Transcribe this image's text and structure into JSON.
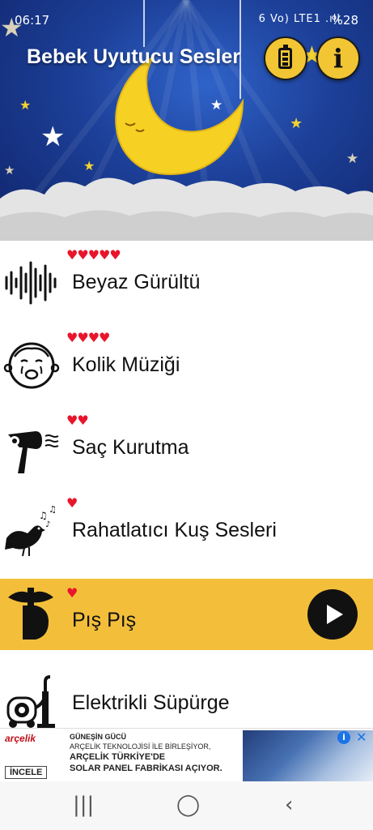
{
  "status_bar": {
    "time": "06:17",
    "icons_text": "6 Vo) LTE1 .ıll",
    "battery": "%28"
  },
  "header": {
    "title": "Bebek Uyutucu Sesler",
    "battery_button_icon": "battery-icon",
    "info_button_label": "i"
  },
  "sounds": [
    {
      "label": "Beyaz Gürültü",
      "hearts": "♥♥♥♥♥",
      "rating": 5,
      "icon": "sound-wave-icon",
      "active": false
    },
    {
      "label": "Kolik Müziği",
      "hearts": "♥♥♥♥",
      "rating": 4,
      "icon": "crying-baby-icon",
      "active": false
    },
    {
      "label": "Saç Kurutma",
      "hearts": "♥♥",
      "rating": 2,
      "icon": "hair-dryer-icon",
      "active": false
    },
    {
      "label": "Rahatlatıcı Kuş Sesleri",
      "hearts": "♥",
      "rating": 1,
      "icon": "singing-bird-icon",
      "active": false
    },
    {
      "label": "Pış Pış",
      "hearts": "♥",
      "rating": 1,
      "icon": "shush-icon",
      "active": true
    },
    {
      "label": "Elektrikli Süpürge",
      "hearts": "",
      "rating": 0,
      "icon": "vacuum-cleaner-icon",
      "active": false
    }
  ],
  "ad": {
    "brand": "arçelik",
    "cta": "İNCELE",
    "line1": "GÜNEŞİN GÜCÜ",
    "line2": "ARÇELİK TEKNOLOJİSİ İLE BİRLEŞİYOR,",
    "line3": "ARÇELİK TÜRKİYE'DE",
    "line4": "SOLAR PANEL FABRİKASI AÇIYOR."
  },
  "navbar": {
    "recents": "|||",
    "home": "◯",
    "back": "‹"
  },
  "colors": {
    "accent": "#f3bf3b",
    "heart": "#e8152b",
    "header_blue": "#1c3f97"
  }
}
